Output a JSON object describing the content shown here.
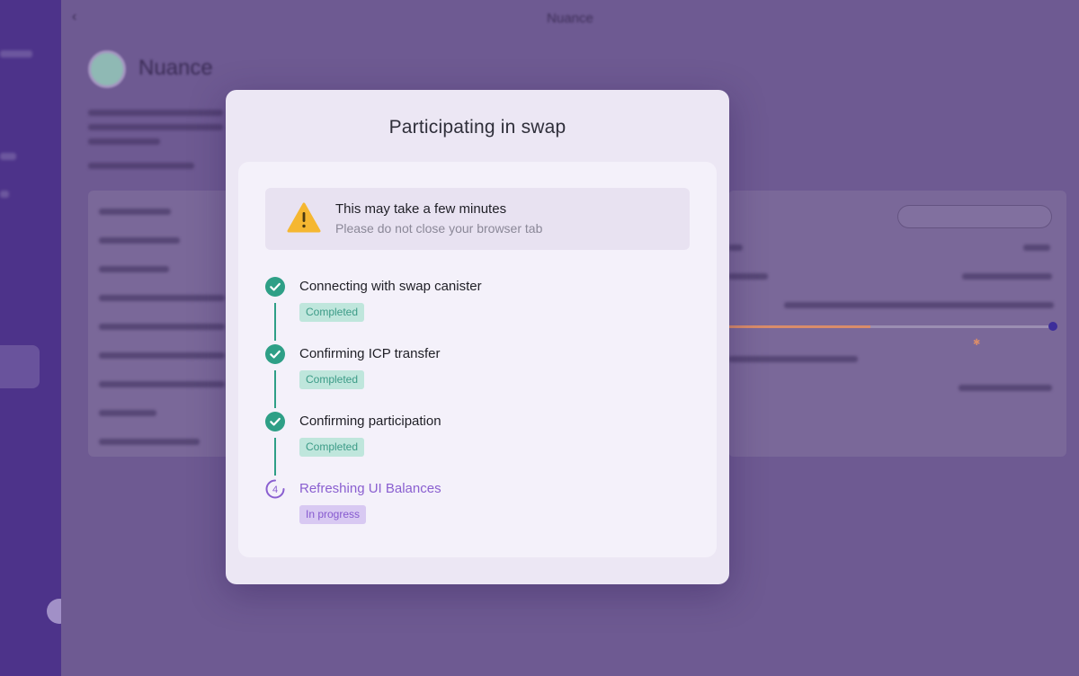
{
  "background": {
    "window_title": "Nuance",
    "project_name": "Nuance"
  },
  "modal": {
    "title": "Participating in swap",
    "alert": {
      "icon": "warning-icon",
      "title": "This may take a few minutes",
      "subtitle": "Please do not close your browser tab"
    },
    "steps": [
      {
        "label": "Connecting with swap canister",
        "status": "Completed",
        "state": "done"
      },
      {
        "label": "Confirming ICP transfer",
        "status": "Completed",
        "state": "done"
      },
      {
        "label": "Confirming participation",
        "status": "Completed",
        "state": "done"
      },
      {
        "label": "Refreshing UI Balances",
        "status": "In progress",
        "state": "in-progress",
        "number": "4"
      }
    ]
  },
  "colors": {
    "accent": "#8a5fd0",
    "success": "#2e9f86",
    "warning": "#f5b731"
  }
}
